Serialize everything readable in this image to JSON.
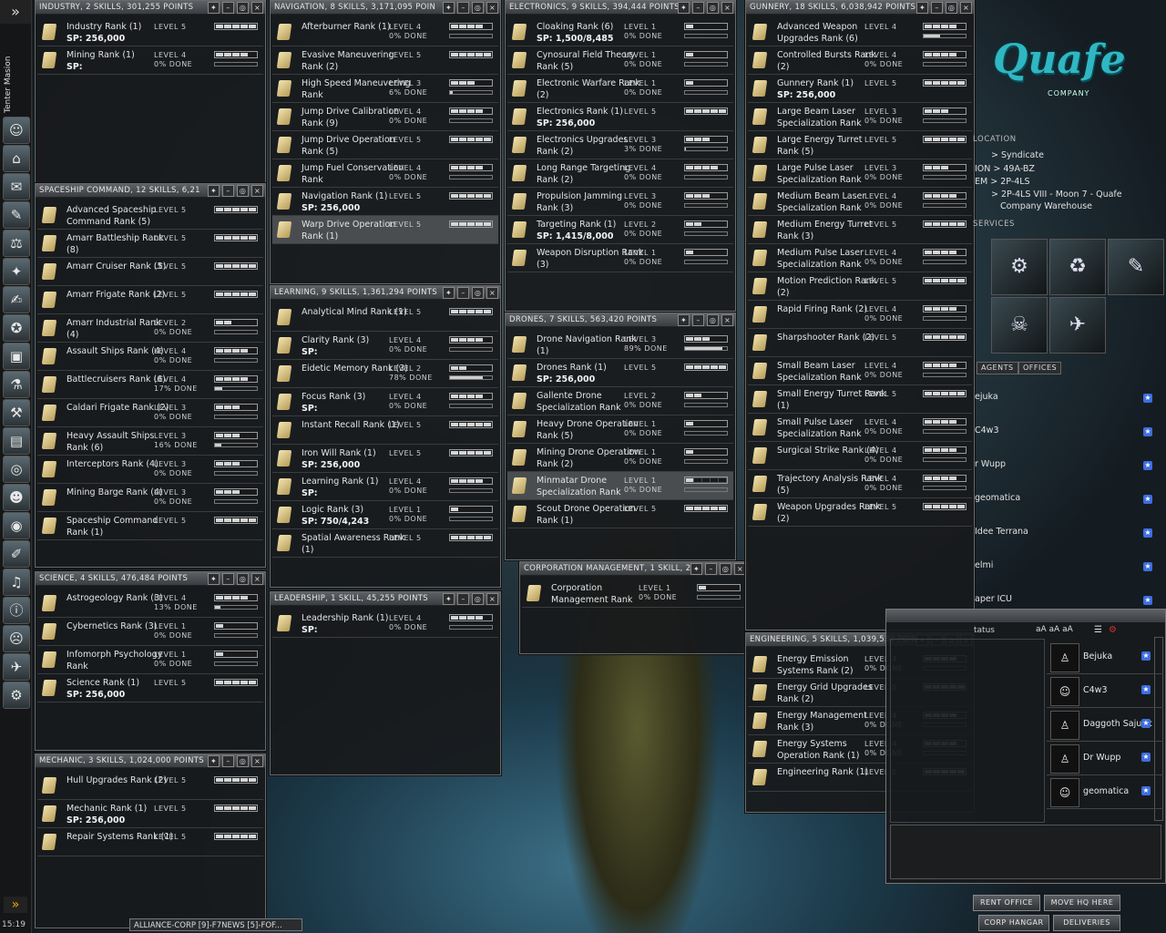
{
  "neocom": {
    "character_name": "Tenter Masion",
    "clock": "15:19",
    "expand_glyph": "»",
    "icons": [
      "character-icon",
      "station-icon",
      "mail-icon",
      "notepad-icon",
      "market-icon",
      "map-icon",
      "contracts-icon",
      "corporation-icon",
      "assets-icon",
      "science-icon",
      "industry-icon",
      "wallet-icon",
      "help-icon",
      "people-icon",
      "network-icon",
      "journal-icon",
      "audio-icon",
      "info-icon",
      "portrait-icon",
      "fitting-icon",
      "drones-icon"
    ]
  },
  "skill_windows": [
    {
      "id": "industry",
      "title": "INDUSTRY, 2 SKILLS, 301,255 POINTS",
      "skills": [
        {
          "name": "Industry Rank (1)",
          "sp": "SP: 256,000",
          "level": "LEVEL 5",
          "done": "",
          "filled": 5,
          "progress": null
        },
        {
          "name": "Mining Rank (1)",
          "sp": "SP:",
          "level": "LEVEL 4",
          "done": "0% DONE",
          "filled": 4,
          "progress": 0
        }
      ]
    },
    {
      "id": "spaceship",
      "title": "SPACESHIP COMMAND, 12 SKILLS, 6,21",
      "skills": [
        {
          "name": "Advanced Spaceship Command Rank (5)",
          "sp": "",
          "level": "LEVEL 5",
          "done": "",
          "filled": 5,
          "progress": null
        },
        {
          "name": "Amarr Battleship Rank (8)",
          "sp": "",
          "level": "LEVEL 5",
          "done": "",
          "filled": 5,
          "progress": null
        },
        {
          "name": "Amarr Cruiser Rank (5)",
          "sp": "",
          "level": "LEVEL 5",
          "done": "",
          "filled": 5,
          "progress": null
        },
        {
          "name": "Amarr Frigate Rank (2)",
          "sp": "",
          "level": "LEVEL 5",
          "done": "",
          "filled": 5,
          "progress": null
        },
        {
          "name": "Amarr Industrial Rank (4)",
          "sp": "",
          "level": "LEVEL 2",
          "done": "0% DONE",
          "filled": 2,
          "progress": 0
        },
        {
          "name": "Assault Ships Rank (4)",
          "sp": "",
          "level": "LEVEL 4",
          "done": "0% DONE",
          "filled": 4,
          "progress": 0
        },
        {
          "name": "Battlecruisers Rank (6)",
          "sp": "",
          "level": "LEVEL 4",
          "done": "17% DONE",
          "filled": 4,
          "progress": 17
        },
        {
          "name": "Caldari Frigate Rank (2)",
          "sp": "",
          "level": "LEVEL 3",
          "done": "0% DONE",
          "filled": 3,
          "progress": 0
        },
        {
          "name": "Heavy Assault Ships Rank (6)",
          "sp": "",
          "level": "LEVEL 3",
          "done": "16% DONE",
          "filled": 3,
          "progress": 16
        },
        {
          "name": "Interceptors Rank (4)",
          "sp": "",
          "level": "LEVEL 3",
          "done": "0% DONE",
          "filled": 3,
          "progress": 0
        },
        {
          "name": "Mining Barge Rank (4)",
          "sp": "",
          "level": "LEVEL 3",
          "done": "0% DONE",
          "filled": 3,
          "progress": 0
        },
        {
          "name": "Spaceship Command Rank (1)",
          "sp": "",
          "level": "LEVEL 5",
          "done": "",
          "filled": 5,
          "progress": null
        }
      ]
    },
    {
      "id": "science",
      "title": "SCIENCE, 4 SKILLS, 476,484 POINTS",
      "skills": [
        {
          "name": "Astrogeology Rank (3)",
          "sp": "",
          "level": "LEVEL 4",
          "done": "13% DONE",
          "filled": 4,
          "progress": 13
        },
        {
          "name": "Cybernetics Rank (3)",
          "sp": "",
          "level": "LEVEL 1",
          "done": "0% DONE",
          "filled": 1,
          "progress": 0
        },
        {
          "name": "Infomorph Psychology Rank",
          "sp": "",
          "level": "LEVEL 1",
          "done": "0% DONE",
          "filled": 1,
          "progress": 0
        },
        {
          "name": "Science Rank (1)",
          "sp": "SP: 256,000",
          "level": "LEVEL 5",
          "done": "",
          "filled": 5,
          "progress": null
        }
      ]
    },
    {
      "id": "mechanic",
      "title": "MECHANIC, 3 SKILLS, 1,024,000 POINTS",
      "skills": [
        {
          "name": "Hull Upgrades Rank (2)",
          "sp": "",
          "level": "LEVEL 5",
          "done": "",
          "filled": 5,
          "progress": null
        },
        {
          "name": "Mechanic Rank (1)",
          "sp": "SP: 256,000",
          "level": "LEVEL 5",
          "done": "",
          "filled": 5,
          "progress": null
        },
        {
          "name": "Repair Systems Rank (1)",
          "sp": "",
          "level": "LEVEL 5",
          "done": "",
          "filled": 5,
          "progress": null
        }
      ]
    },
    {
      "id": "navigation",
      "title": "NAVIGATION, 8 SKILLS, 3,171,095 POIN",
      "skills": [
        {
          "name": "Afterburner Rank (1)",
          "sp": "",
          "level": "LEVEL 4",
          "done": "0% DONE",
          "filled": 4,
          "progress": 0
        },
        {
          "name": "Evasive Maneuvering Rank (2)",
          "sp": "",
          "level": "LEVEL 5",
          "done": "",
          "filled": 5,
          "progress": null
        },
        {
          "name": "High Speed Maneuvering Rank",
          "sp": "",
          "level": "LEVEL 3",
          "done": "6% DONE",
          "filled": 3,
          "progress": 6
        },
        {
          "name": "Jump Drive Calibration Rank (9)",
          "sp": "",
          "level": "LEVEL 4",
          "done": "0% DONE",
          "filled": 4,
          "progress": 0
        },
        {
          "name": "Jump Drive Operation Rank (5)",
          "sp": "",
          "level": "LEVEL 5",
          "done": "",
          "filled": 5,
          "progress": null
        },
        {
          "name": "Jump Fuel Conservation Rank",
          "sp": "",
          "level": "LEVEL 4",
          "done": "0% DONE",
          "filled": 4,
          "progress": 0
        },
        {
          "name": "Navigation Rank (1)",
          "sp": "SP: 256,000",
          "level": "LEVEL 5",
          "done": "",
          "filled": 5,
          "progress": null
        },
        {
          "name": "Warp Drive Operation Rank (1)",
          "sp": "",
          "level": "LEVEL 5",
          "done": "",
          "filled": 5,
          "progress": null,
          "selected": true
        }
      ]
    },
    {
      "id": "learning",
      "title": "LEARNING, 9 SKILLS, 1,361,294 POINTS",
      "skills": [
        {
          "name": "Analytical Mind Rank (1)",
          "sp": "",
          "level": "LEVEL 5",
          "done": "",
          "filled": 5,
          "progress": null
        },
        {
          "name": "Clarity Rank (3)",
          "sp": "SP:",
          "level": "LEVEL 4",
          "done": "0% DONE",
          "filled": 4,
          "progress": 0
        },
        {
          "name": "Eidetic Memory Rank (3)",
          "sp": "",
          "level": "LEVEL 2",
          "done": "78% DONE",
          "filled": 2,
          "progress": 78
        },
        {
          "name": "Focus Rank (3)",
          "sp": "SP:",
          "level": "LEVEL 4",
          "done": "0% DONE",
          "filled": 4,
          "progress": 0
        },
        {
          "name": "Instant Recall Rank (1)",
          "sp": "",
          "level": "LEVEL 5",
          "done": "",
          "filled": 5,
          "progress": null
        },
        {
          "name": "Iron Will Rank (1)",
          "sp": "SP: 256,000",
          "level": "LEVEL 5",
          "done": "",
          "filled": 5,
          "progress": null
        },
        {
          "name": "Learning Rank (1)",
          "sp": "SP:",
          "level": "LEVEL 4",
          "done": "0% DONE",
          "filled": 4,
          "progress": 0
        },
        {
          "name": "Logic Rank (3)",
          "sp": "SP: 750/4,243",
          "level": "LEVEL 1",
          "done": "0% DONE",
          "filled": 1,
          "progress": 0
        },
        {
          "name": "Spatial Awareness Rank (1)",
          "sp": "",
          "level": "LEVEL 5",
          "done": "",
          "filled": 5,
          "progress": null
        }
      ]
    },
    {
      "id": "leadership",
      "title": "LEADERSHIP, 1 SKILL, 45,255 POINTS",
      "skills": [
        {
          "name": "Leadership Rank (1)",
          "sp": "SP:",
          "level": "LEVEL 4",
          "done": "0% DONE",
          "filled": 4,
          "progress": 0
        }
      ]
    },
    {
      "id": "electronics",
      "title": "ELECTRONICS, 9 SKILLS, 394,444 POINTS",
      "skills": [
        {
          "name": "Cloaking Rank (6)",
          "sp": "SP: 1,500/8,485",
          "level": "LEVEL 1",
          "done": "0% DONE",
          "filled": 1,
          "progress": 0
        },
        {
          "name": "Cynosural Field Theory Rank (5)",
          "sp": "",
          "level": "LEVEL 1",
          "done": "0% DONE",
          "filled": 1,
          "progress": 0
        },
        {
          "name": "Electronic Warfare Rank (2)",
          "sp": "",
          "level": "LEVEL 1",
          "done": "0% DONE",
          "filled": 1,
          "progress": 0
        },
        {
          "name": "Electronics Rank (1)",
          "sp": "SP: 256,000",
          "level": "LEVEL 5",
          "done": "",
          "filled": 5,
          "progress": null
        },
        {
          "name": "Electronics Upgrades Rank (2)",
          "sp": "",
          "level": "LEVEL 3",
          "done": "3% DONE",
          "filled": 3,
          "progress": 3
        },
        {
          "name": "Long Range Targeting Rank (2)",
          "sp": "",
          "level": "LEVEL 4",
          "done": "0% DONE",
          "filled": 4,
          "progress": 0
        },
        {
          "name": "Propulsion Jamming Rank (3)",
          "sp": "",
          "level": "LEVEL 3",
          "done": "0% DONE",
          "filled": 3,
          "progress": 0
        },
        {
          "name": "Targeting Rank (1)",
          "sp": "SP: 1,415/8,000",
          "level": "LEVEL 2",
          "done": "0% DONE",
          "filled": 2,
          "progress": 0
        },
        {
          "name": "Weapon Disruption Rank (3)",
          "sp": "",
          "level": "LEVEL 1",
          "done": "0% DONE",
          "filled": 1,
          "progress": 0
        }
      ]
    },
    {
      "id": "drones",
      "title": "DRONES, 7 SKILLS, 563,420 POINTS",
      "skills": [
        {
          "name": "Drone Navigation Rank (1)",
          "sp": "",
          "level": "LEVEL 3",
          "done": "89% DONE",
          "filled": 3,
          "progress": 89
        },
        {
          "name": "Drones Rank (1)",
          "sp": "SP: 256,000",
          "level": "LEVEL 5",
          "done": "",
          "filled": 5,
          "progress": null
        },
        {
          "name": "Gallente Drone Specialization Rank",
          "sp": "",
          "level": "LEVEL 2",
          "done": "0% DONE",
          "filled": 2,
          "progress": 0
        },
        {
          "name": "Heavy Drone Operation Rank (5)",
          "sp": "",
          "level": "LEVEL 1",
          "done": "0% DONE",
          "filled": 1,
          "progress": 0
        },
        {
          "name": "Mining Drone Operation Rank (2)",
          "sp": "",
          "level": "LEVEL 1",
          "done": "0% DONE",
          "filled": 1,
          "progress": 0
        },
        {
          "name": "Minmatar Drone Specialization Rank",
          "sp": "",
          "level": "LEVEL 1",
          "done": "0% DONE",
          "filled": 1,
          "progress": 0,
          "selected": true
        },
        {
          "name": "Scout Drone Operation Rank (1)",
          "sp": "",
          "level": "LEVEL 5",
          "done": "",
          "filled": 5,
          "progress": null
        }
      ]
    },
    {
      "id": "corpmgmt",
      "title": "CORPORATION MANAGEMENT, 1 SKILL, 2",
      "skills": [
        {
          "name": "Corporation Management Rank",
          "sp": "",
          "level": "LEVEL 1",
          "done": "0% DONE",
          "filled": 1,
          "progress": 0
        }
      ]
    },
    {
      "id": "gunnery",
      "title": "GUNNERY, 18 SKILLS, 6,038,942 POINTS",
      "skills": [
        {
          "name": "Advanced Weapon Upgrades Rank (6)",
          "sp": "",
          "level": "LEVEL 4",
          "done": "",
          "filled": 4,
          "progress": 40
        },
        {
          "name": "Controlled Bursts Rank (2)",
          "sp": "",
          "level": "LEVEL 4",
          "done": "0% DONE",
          "filled": 4,
          "progress": 0
        },
        {
          "name": "Gunnery Rank (1)",
          "sp": "SP: 256,000",
          "level": "LEVEL 5",
          "done": "",
          "filled": 5,
          "progress": null
        },
        {
          "name": "Large Beam Laser Specialization Rank",
          "sp": "",
          "level": "LEVEL 3",
          "done": "0% DONE",
          "filled": 3,
          "progress": 0
        },
        {
          "name": "Large Energy Turret Rank (5)",
          "sp": "",
          "level": "LEVEL 5",
          "done": "",
          "filled": 5,
          "progress": null
        },
        {
          "name": "Large Pulse Laser Specialization Rank",
          "sp": "",
          "level": "LEVEL 3",
          "done": "0% DONE",
          "filled": 3,
          "progress": 0
        },
        {
          "name": "Medium Beam Laser Specialization Rank",
          "sp": "",
          "level": "LEVEL 4",
          "done": "0% DONE",
          "filled": 4,
          "progress": 0
        },
        {
          "name": "Medium Energy Turret Rank (3)",
          "sp": "",
          "level": "LEVEL 5",
          "done": "",
          "filled": 5,
          "progress": null
        },
        {
          "name": "Medium Pulse Laser Specialization Rank",
          "sp": "",
          "level": "LEVEL 4",
          "done": "0% DONE",
          "filled": 4,
          "progress": 0
        },
        {
          "name": "Motion Prediction Rank (2)",
          "sp": "",
          "level": "LEVEL 5",
          "done": "",
          "filled": 5,
          "progress": null
        },
        {
          "name": "Rapid Firing Rank (2)",
          "sp": "",
          "level": "LEVEL 4",
          "done": "0% DONE",
          "filled": 4,
          "progress": 0
        },
        {
          "name": "Sharpshooter Rank (2)",
          "sp": "",
          "level": "LEVEL 5",
          "done": "",
          "filled": 5,
          "progress": null
        },
        {
          "name": "Small Beam Laser Specialization Rank",
          "sp": "",
          "level": "LEVEL 4",
          "done": "0% DONE",
          "filled": 4,
          "progress": 0
        },
        {
          "name": "Small Energy Turret Rank (1)",
          "sp": "",
          "level": "LEVEL 5",
          "done": "",
          "filled": 5,
          "progress": null
        },
        {
          "name": "Small Pulse Laser Specialization Rank",
          "sp": "",
          "level": "LEVEL 4",
          "done": "0% DONE",
          "filled": 4,
          "progress": 0
        },
        {
          "name": "Surgical Strike Rank (4)",
          "sp": "",
          "level": "LEVEL 4",
          "done": "0% DONE",
          "filled": 4,
          "progress": 0
        },
        {
          "name": "Trajectory Analysis Rank (5)",
          "sp": "",
          "level": "LEVEL 4",
          "done": "0% DONE",
          "filled": 4,
          "progress": 0
        },
        {
          "name": "Weapon Upgrades Rank (2)",
          "sp": "",
          "level": "LEVEL 5",
          "done": "",
          "filled": 5,
          "progress": null
        }
      ]
    },
    {
      "id": "engineering",
      "title": "ENGINEERING, 5 SKILLS, 1,039,530 POIN",
      "skills": [
        {
          "name": "Energy Emission Systems Rank (2)",
          "sp": "",
          "level": "LEVEL 4",
          "done": "0% DONE",
          "filled": 4,
          "progress": 0
        },
        {
          "name": "Energy Grid Upgrades Rank (2)",
          "sp": "",
          "level": "LEVEL 5",
          "done": "",
          "filled": 5,
          "progress": null
        },
        {
          "name": "Energy Management Rank (3)",
          "sp": "",
          "level": "LEVEL 4",
          "done": "0% DONE",
          "filled": 4,
          "progress": 0
        },
        {
          "name": "Energy Systems Operation Rank (1)",
          "sp": "",
          "level": "LEVEL 4",
          "done": "0% DONE",
          "filled": 4,
          "progress": 0
        },
        {
          "name": "Engineering Rank (1)",
          "sp": "",
          "level": "LEVEL 5",
          "done": "",
          "filled": 5,
          "progress": null
        }
      ]
    }
  ],
  "station": {
    "logo": "Quafe",
    "logo_sub": "COMPANY",
    "location_header": "LOCATION",
    "location": {
      "alliance": "Syndicate",
      "region": "49A-BZ",
      "system": "2P-4LS",
      "station": "2P-4LS VIII - Moon 7 - Quafe",
      "station2": "Company Warehouse",
      "label_region": "ION",
      "label_system": "EM"
    },
    "services_header": "SERVICES",
    "services": [
      "repair-icon",
      "reprocessing-icon",
      "fitting-icon",
      "lp-store-icon",
      "clone-icon",
      "insurance-icon"
    ],
    "tabs": [
      "AGENTS",
      "OFFICES"
    ],
    "agents": [
      "ejuka",
      "C4w3",
      "r Wupp",
      "geomatica",
      "Idee Terrana",
      "elmi",
      "aper ICU"
    ],
    "buttons": {
      "rent": "RENT OFFICE",
      "movehq": "MOVE HQ HERE",
      "hangar": "CORP HANGAR",
      "deliveries": "DELIVERIES"
    }
  },
  "chat": {
    "status_label": "tatus",
    "font_buttons": [
      "aA",
      "aA",
      "aA"
    ],
    "members": [
      {
        "name": "Bejuka",
        "avatar": "figure"
      },
      {
        "name": "C4w3",
        "avatar": "portrait"
      },
      {
        "name": "Daggoth Sajuuk",
        "avatar": "figure"
      },
      {
        "name": "Dr Wupp",
        "avatar": "figure"
      },
      {
        "name": "geomatica",
        "avatar": "portrait"
      }
    ]
  },
  "taskbar": {
    "label": "ALLIANCE-CORP [9]-F7NEWS [5]-FOF..."
  }
}
